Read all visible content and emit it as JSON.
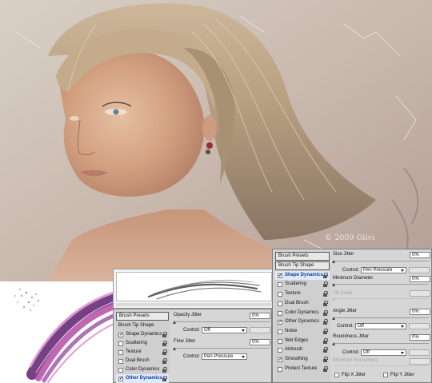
{
  "artwork": {
    "signature": "© 2009 Olivi"
  },
  "left_panel": {
    "presets_header": "Brush Presets",
    "items": [
      {
        "label": "Brush Tip Shape",
        "checkbox": false,
        "checked": false,
        "lock": false,
        "selected": false
      },
      {
        "label": "Shape Dynamics",
        "checkbox": true,
        "checked": true,
        "lock": true,
        "selected": false
      },
      {
        "label": "Scattering",
        "checkbox": true,
        "checked": false,
        "lock": true,
        "selected": false
      },
      {
        "label": "Texture",
        "checkbox": true,
        "checked": false,
        "lock": true,
        "selected": false
      },
      {
        "label": "Dual Brush",
        "checkbox": true,
        "checked": false,
        "lock": true,
        "selected": false
      },
      {
        "label": "Color Dynamics",
        "checkbox": true,
        "checked": false,
        "lock": true,
        "selected": false
      },
      {
        "label": "Other Dynamics",
        "checkbox": true,
        "checked": true,
        "lock": true,
        "selected": true
      }
    ],
    "opacity_jitter": {
      "label": "Opacity Jitter",
      "value": "0%",
      "control_label": "Control:",
      "control_value": "Off"
    },
    "flow_jitter": {
      "label": "Flow Jitter",
      "value": "0%",
      "control_label": "Control:",
      "control_value": "Pen Pressure"
    }
  },
  "right_panel": {
    "presets_header": "Brush Presets",
    "items": [
      {
        "label": "Brush Tip Shape",
        "checkbox": false,
        "checked": false,
        "lock": false,
        "selected": false,
        "header": true
      },
      {
        "label": "Shape Dynamics",
        "checkbox": true,
        "checked": true,
        "lock": true,
        "selected": true
      },
      {
        "label": "Scattering",
        "checkbox": true,
        "checked": false,
        "lock": true,
        "selected": false
      },
      {
        "label": "Texture",
        "checkbox": true,
        "checked": false,
        "lock": true,
        "selected": false
      },
      {
        "label": "Dual Brush",
        "checkbox": true,
        "checked": false,
        "lock": true,
        "selected": false
      },
      {
        "label": "Color Dynamics",
        "checkbox": true,
        "checked": false,
        "lock": true,
        "selected": false
      },
      {
        "label": "Other Dynamics",
        "checkbox": true,
        "checked": true,
        "lock": true,
        "selected": false
      },
      {
        "label": "Noise",
        "checkbox": true,
        "checked": false,
        "lock": true,
        "selected": false
      },
      {
        "label": "Wet Edges",
        "checkbox": true,
        "checked": false,
        "lock": true,
        "selected": false
      },
      {
        "label": "Airbrush",
        "checkbox": true,
        "checked": false,
        "lock": true,
        "selected": false
      },
      {
        "label": "Smoothing",
        "checkbox": true,
        "checked": true,
        "lock": true,
        "selected": false
      },
      {
        "label": "Protect Texture",
        "checkbox": true,
        "checked": false,
        "lock": true,
        "selected": false
      }
    ],
    "size_jitter": {
      "label": "Size Jitter",
      "value": "0%",
      "control_label": "Control:",
      "control_value": "Pen Pressure"
    },
    "minimum_diameter": {
      "label": "Minimum Diameter",
      "value": "0%"
    },
    "tilt_scale": {
      "label": "Tilt Scale"
    },
    "angle_jitter": {
      "label": "Angle Jitter",
      "value": "0%",
      "control_label": "Control:",
      "control_value": "Off"
    },
    "roundness_jitter": {
      "label": "Roundness Jitter",
      "value": "0%",
      "control_label": "Control:",
      "control_value": "Off"
    },
    "minimum_roundness": {
      "label": "Minimum Roundness"
    },
    "flip_x": {
      "label": "Flip X Jitter"
    },
    "flip_y": {
      "label": "Flip Y Jitter"
    }
  }
}
